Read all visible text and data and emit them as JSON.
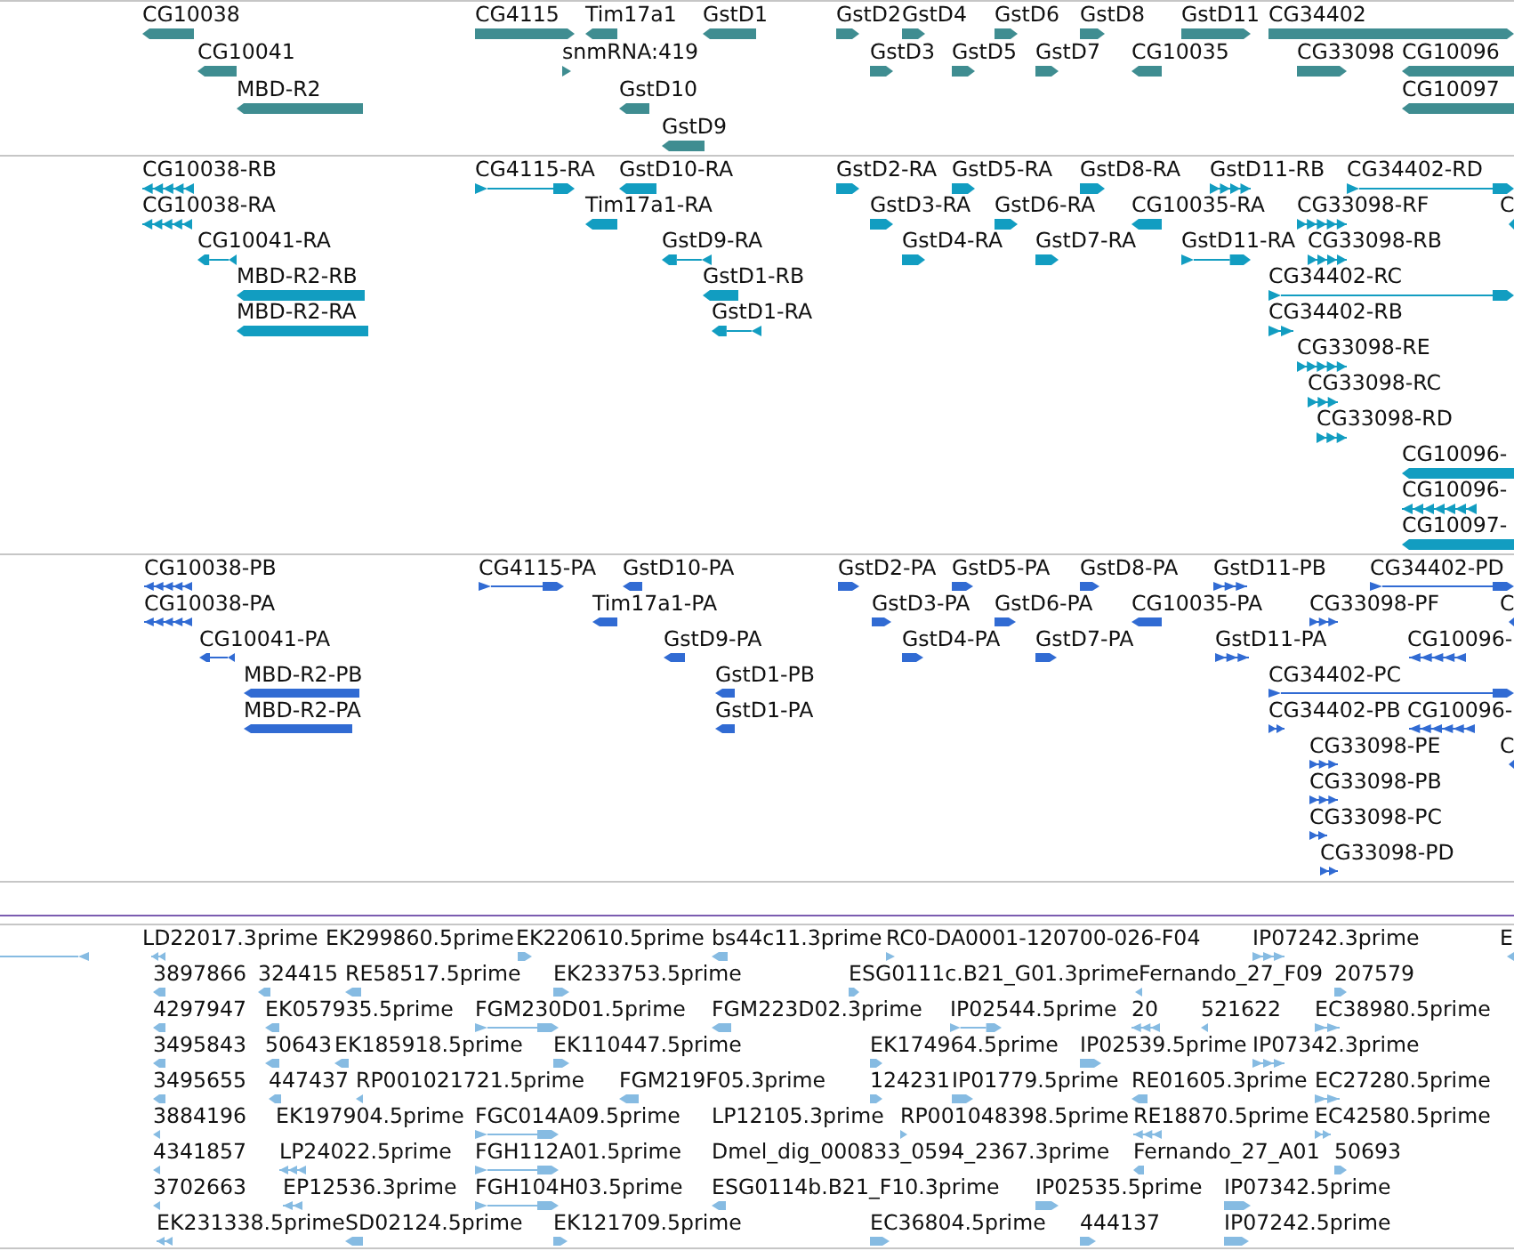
{
  "tracks": [
    {
      "kind": "gene",
      "features": [
        {
          "label": "CG10038",
          "reverse": true
        },
        {
          "label": "CG4115",
          "reverse": false
        },
        {
          "label": "Tim17a1",
          "reverse": true
        },
        {
          "label": "GstD1",
          "reverse": true
        },
        {
          "label": "GstD2",
          "reverse": false
        },
        {
          "label": "GstD4",
          "reverse": false
        },
        {
          "label": "GstD6",
          "reverse": false
        },
        {
          "label": "GstD8",
          "reverse": false
        },
        {
          "label": "GstD11",
          "reverse": false
        },
        {
          "label": "CG34402",
          "reverse": false
        },
        {
          "label": "CG10041",
          "reverse": true
        },
        {
          "label": "snmRNA:419",
          "reverse": false
        },
        {
          "label": "GstD3",
          "reverse": false
        },
        {
          "label": "GstD5",
          "reverse": false
        },
        {
          "label": "GstD7",
          "reverse": false
        },
        {
          "label": "CG10035",
          "reverse": true
        },
        {
          "label": "CG33098",
          "reverse": false
        },
        {
          "label": "CG10096",
          "reverse": true
        },
        {
          "label": "MBD-R2",
          "reverse": true
        },
        {
          "label": "GstD10",
          "reverse": true
        },
        {
          "label": "CG10097",
          "reverse": true
        },
        {
          "label": "GstD9",
          "reverse": true
        }
      ]
    },
    {
      "kind": "transcript",
      "features": [
        {
          "label": "CG10038-RB",
          "reverse": true
        },
        {
          "label": "CG4115-RA",
          "reverse": false
        },
        {
          "label": "GstD10-RA",
          "reverse": true
        },
        {
          "label": "GstD2-RA",
          "reverse": false
        },
        {
          "label": "GstD5-RA",
          "reverse": false
        },
        {
          "label": "GstD8-RA",
          "reverse": false
        },
        {
          "label": "GstD11-RB",
          "reverse": false
        },
        {
          "label": "CG34402-RD",
          "reverse": false
        },
        {
          "label": "CG10038-RA",
          "reverse": true
        },
        {
          "label": "Tim17a1-RA",
          "reverse": true
        },
        {
          "label": "GstD3-RA",
          "reverse": false
        },
        {
          "label": "GstD6-RA",
          "reverse": false
        },
        {
          "label": "CG10035-RA",
          "reverse": true
        },
        {
          "label": "CG33098-RF",
          "reverse": false
        },
        {
          "label": "C",
          "reverse": true
        },
        {
          "label": "CG10041-RA",
          "reverse": true
        },
        {
          "label": "GstD9-RA",
          "reverse": true
        },
        {
          "label": "GstD4-RA",
          "reverse": false
        },
        {
          "label": "GstD7-RA",
          "reverse": false
        },
        {
          "label": "GstD11-RA",
          "reverse": false
        },
        {
          "label": "CG33098-RB",
          "reverse": false
        },
        {
          "label": "MBD-R2-RB",
          "reverse": true
        },
        {
          "label": "GstD1-RB",
          "reverse": true
        },
        {
          "label": "CG34402-RC",
          "reverse": false
        },
        {
          "label": "MBD-R2-RA",
          "reverse": true
        },
        {
          "label": "GstD1-RA",
          "reverse": true
        },
        {
          "label": "CG34402-RB",
          "reverse": false
        },
        {
          "label": "CG33098-RE",
          "reverse": false
        },
        {
          "label": "CG33098-RC",
          "reverse": false
        },
        {
          "label": "CG33098-RD",
          "reverse": false
        },
        {
          "label": "CG10096-",
          "reverse": true
        },
        {
          "label": "CG10096-",
          "reverse": true
        },
        {
          "label": "CG10097-",
          "reverse": true
        }
      ]
    },
    {
      "kind": "protein",
      "features": [
        {
          "label": "CG10038-PB",
          "reverse": true
        },
        {
          "label": "CG4115-PA",
          "reverse": false
        },
        {
          "label": "GstD10-PA",
          "reverse": true
        },
        {
          "label": "GstD2-PA",
          "reverse": false
        },
        {
          "label": "GstD5-PA",
          "reverse": false
        },
        {
          "label": "GstD8-PA",
          "reverse": false
        },
        {
          "label": "GstD11-PB",
          "reverse": false
        },
        {
          "label": "CG34402-PD",
          "reverse": false
        },
        {
          "label": "CG10038-PA",
          "reverse": true
        },
        {
          "label": "Tim17a1-PA",
          "reverse": true
        },
        {
          "label": "GstD3-PA",
          "reverse": false
        },
        {
          "label": "GstD6-PA",
          "reverse": false
        },
        {
          "label": "CG10035-PA",
          "reverse": true
        },
        {
          "label": "CG33098-PF",
          "reverse": false
        },
        {
          "label": "C",
          "reverse": true
        },
        {
          "label": "CG10041-PA",
          "reverse": true
        },
        {
          "label": "GstD9-PA",
          "reverse": true
        },
        {
          "label": "GstD4-PA",
          "reverse": false
        },
        {
          "label": "GstD7-PA",
          "reverse": false
        },
        {
          "label": "GstD11-PA",
          "reverse": false
        },
        {
          "label": "CG10096-",
          "reverse": true
        },
        {
          "label": "MBD-R2-PB",
          "reverse": true
        },
        {
          "label": "GstD1-PB",
          "reverse": true
        },
        {
          "label": "CG34402-PC",
          "reverse": false
        },
        {
          "label": "MBD-R2-PA",
          "reverse": true
        },
        {
          "label": "GstD1-PA",
          "reverse": true
        },
        {
          "label": "CG34402-PB",
          "reverse": false
        },
        {
          "label": "CG10096-",
          "reverse": true
        },
        {
          "label": "CG33098-PE",
          "reverse": false
        },
        {
          "label": "C",
          "reverse": true
        },
        {
          "label": "CG33098-PB",
          "reverse": false
        },
        {
          "label": "CG33098-PC",
          "reverse": false
        },
        {
          "label": "CG33098-PD",
          "reverse": false
        }
      ]
    },
    {
      "kind": "est",
      "features": [
        {
          "reverse": true
        },
        {
          "label": "LD22017.3prime",
          "reverse": true
        },
        {
          "label": "EK299860.5prime"
        },
        {
          "label": "EK220610.5prime",
          "reverse": false
        },
        {
          "label": "bs44c11.3prime",
          "reverse": true
        },
        {
          "label": "RC0-DA0001-120700-026-F04",
          "reverse": false
        },
        {
          "label": "IP07242.3prime",
          "reverse": false
        },
        {
          "label": "E",
          "reverse": true
        },
        {
          "label": "3897866",
          "reverse": true
        },
        {
          "label": "324415",
          "reverse": true
        },
        {
          "label": "RE58517.5prime",
          "reverse": true
        },
        {
          "label": "EK233753.5prime",
          "reverse": false
        },
        {
          "label": "ESG0111c.B21_G01.3prime",
          "reverse": false
        },
        {
          "label": "Fernando_27_F09",
          "reverse": true
        },
        {
          "label": "207579",
          "reverse": false
        },
        {
          "label": "4297947",
          "reverse": true
        },
        {
          "label": "EK057935.5prime",
          "reverse": true
        },
        {
          "label": "FGM230D01.5prime",
          "reverse": false
        },
        {
          "label": "FGM223D02.3prime",
          "reverse": true
        },
        {
          "label": "IP02544.5prime",
          "reverse": false
        },
        {
          "label": "20",
          "reverse": true
        },
        {
          "label": "521622",
          "reverse": true
        },
        {
          "label": "EC38980.5prime",
          "reverse": false
        },
        {
          "label": "3495843",
          "reverse": true
        },
        {
          "label": "50643",
          "reverse": true
        },
        {
          "label": "EK185918.5prime",
          "reverse": true
        },
        {
          "label": "EK110447.5prime",
          "reverse": false
        },
        {
          "label": "EK174964.5prime",
          "reverse": false
        },
        {
          "label": "IP02539.5prime",
          "reverse": false
        },
        {
          "label": "IP07342.3prime",
          "reverse": false
        },
        {
          "label": "3495655",
          "reverse": true
        },
        {
          "label": "447437",
          "reverse": true
        },
        {
          "label": "RP001021721.5prime",
          "reverse": true
        },
        {
          "label": "FGM219F05.3prime",
          "reverse": true
        },
        {
          "label": "124231",
          "reverse": false
        },
        {
          "label": "IP01779.5prime",
          "reverse": false
        },
        {
          "label": "RE01605.3prime",
          "reverse": true
        },
        {
          "label": "EC27280.5prime",
          "reverse": false
        },
        {
          "label": "3884196",
          "reverse": true
        },
        {
          "label": "EK197904.5prime"
        },
        {
          "label": "FGC014A09.5prime",
          "reverse": false
        },
        {
          "label": "LP12105.3prime"
        },
        {
          "label": "RP001048398.5prime",
          "reverse": false
        },
        {
          "label": "RE18870.5prime",
          "reverse": true
        },
        {
          "label": "EC42580.5prime",
          "reverse": false
        },
        {
          "label": "4341857",
          "reverse": true
        },
        {
          "label": "LP24022.5prime",
          "reverse": true
        },
        {
          "label": "FGH112A01.5prime",
          "reverse": false
        },
        {
          "label": "Dmel_dig_000833_0594_2367.3prime"
        },
        {
          "label": "Fernando_27_A01",
          "reverse": true
        },
        {
          "label": "50693",
          "reverse": false
        },
        {
          "label": "3702663",
          "reverse": true
        },
        {
          "label": "EP12536.3prime",
          "reverse": true
        },
        {
          "label": "FGH104H03.5prime",
          "reverse": false
        },
        {
          "label": "ESG0114b.B21_F10.3prime",
          "reverse": true
        },
        {
          "label": "IP02535.5prime",
          "reverse": false
        },
        {
          "label": "IP07342.5prime",
          "reverse": false
        },
        {
          "label": "EK231338.5prime",
          "reverse": true
        },
        {
          "label": "SD02124.5prime",
          "reverse": true
        },
        {
          "label": "EK121709.5prime",
          "reverse": false
        },
        {
          "label": "EC36804.5prime",
          "reverse": false
        },
        {
          "label": "444137",
          "reverse": false
        },
        {
          "label": "IP07242.5prime",
          "reverse": false
        }
      ]
    }
  ]
}
